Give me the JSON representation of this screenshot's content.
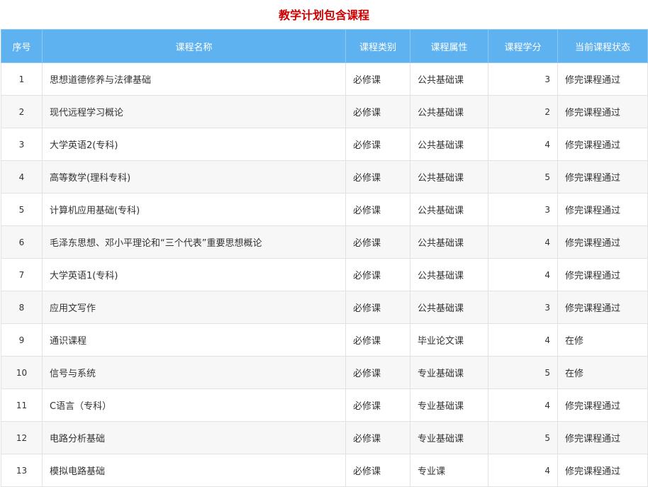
{
  "title": "教学计划包含课程",
  "headers": {
    "no": "序号",
    "name": "课程名称",
    "category": "课程类别",
    "attribute": "课程属性",
    "credit": "课程学分",
    "status": "当前课程状态"
  },
  "rows": [
    {
      "no": "1",
      "name": "思想道德修养与法律基础",
      "category": "必修课",
      "attribute": "公共基础课",
      "credit": "3",
      "status": "修完课程通过"
    },
    {
      "no": "2",
      "name": "现代远程学习概论",
      "category": "必修课",
      "attribute": "公共基础课",
      "credit": "2",
      "status": "修完课程通过"
    },
    {
      "no": "3",
      "name": "大学英语2(专科)",
      "category": "必修课",
      "attribute": "公共基础课",
      "credit": "4",
      "status": "修完课程通过"
    },
    {
      "no": "4",
      "name": "高等数学(理科专科)",
      "category": "必修课",
      "attribute": "公共基础课",
      "credit": "5",
      "status": "修完课程通过"
    },
    {
      "no": "5",
      "name": "计算机应用基础(专科)",
      "category": "必修课",
      "attribute": "公共基础课",
      "credit": "3",
      "status": "修完课程通过"
    },
    {
      "no": "6",
      "name": "毛泽东思想、邓小平理论和“三个代表”重要思想概论",
      "category": "必修课",
      "attribute": "公共基础课",
      "credit": "4",
      "status": "修完课程通过"
    },
    {
      "no": "7",
      "name": "大学英语1(专科)",
      "category": "必修课",
      "attribute": "公共基础课",
      "credit": "4",
      "status": "修完课程通过"
    },
    {
      "no": "8",
      "name": "应用文写作",
      "category": "必修课",
      "attribute": "公共基础课",
      "credit": "3",
      "status": "修完课程通过"
    },
    {
      "no": "9",
      "name": "通识课程",
      "category": "必修课",
      "attribute": "毕业论文课",
      "credit": "4",
      "status": "在修"
    },
    {
      "no": "10",
      "name": "信号与系统",
      "category": "必修课",
      "attribute": "专业基础课",
      "credit": "5",
      "status": "在修"
    },
    {
      "no": "11",
      "name": "C语言（专科）",
      "category": "必修课",
      "attribute": "专业基础课",
      "credit": "4",
      "status": "修完课程通过"
    },
    {
      "no": "12",
      "name": "电路分析基础",
      "category": "必修课",
      "attribute": "专业基础课",
      "credit": "5",
      "status": "修完课程通过"
    },
    {
      "no": "13",
      "name": "模拟电路基础",
      "category": "必修课",
      "attribute": "专业课",
      "credit": "4",
      "status": "修完课程通过"
    }
  ],
  "colors": {
    "title": "#cc0000",
    "header_bg": "#5fb2f0",
    "row_alt_bg": "#f7f7f7",
    "border": "#e2e2e2"
  }
}
